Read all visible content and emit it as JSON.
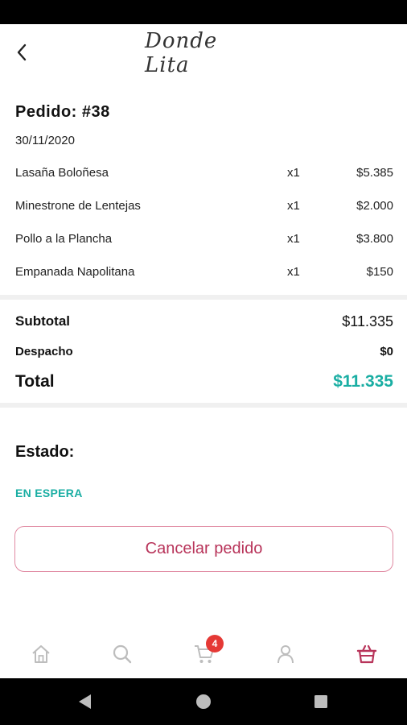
{
  "header": {
    "logo_text": "Donde Lita"
  },
  "order": {
    "title": "Pedido: #38",
    "date": "30/11/2020",
    "items": [
      {
        "name": "Lasaña Boloñesa",
        "qty": "x1",
        "price": "$5.385"
      },
      {
        "name": "Minestrone de Lentejas",
        "qty": "x1",
        "price": "$2.000"
      },
      {
        "name": "Pollo a la Plancha",
        "qty": "x1",
        "price": "$3.800"
      },
      {
        "name": "Empanada Napolitana",
        "qty": "x1",
        "price": "$150"
      }
    ]
  },
  "summary": {
    "subtotal_label": "Subtotal",
    "subtotal_value": "$11.335",
    "despacho_label": "Despacho",
    "despacho_value": "$0",
    "total_label": "Total",
    "total_value": "$11.335"
  },
  "status": {
    "label": "Estado:",
    "value": "EN ESPERA"
  },
  "actions": {
    "cancel_label": "Cancelar pedido"
  },
  "nav": {
    "items": [
      {
        "icon": "home-icon"
      },
      {
        "icon": "search-icon"
      },
      {
        "icon": "cart-icon",
        "badge": "4"
      },
      {
        "icon": "user-icon"
      },
      {
        "icon": "basket-icon"
      }
    ]
  },
  "colors": {
    "accent_teal": "#1aaea3",
    "accent_pink": "#b8345a",
    "badge_red": "#e53935",
    "nav_inactive": "#bdbdbd"
  }
}
